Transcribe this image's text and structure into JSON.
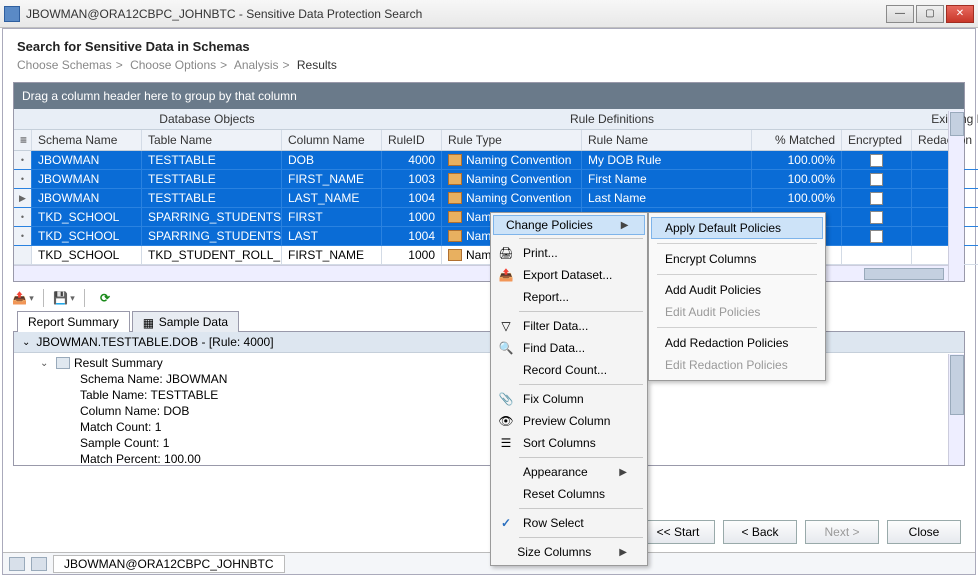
{
  "window": {
    "title": "JBOWMAN@ORA12CBPC_JOHNBTC - Sensitive Data Protection Search"
  },
  "header": {
    "title": "Search for Sensitive Data in Schemas",
    "crumbs": [
      "Choose Schemas",
      "Choose Options",
      "Analysis",
      "Results"
    ]
  },
  "grid": {
    "group_hint": "Drag a column header here to group by that column",
    "bands": {
      "db": "Database Objects",
      "rules": "Rule Definitions",
      "policies": "Existing Policies"
    },
    "cols": {
      "schema": "Schema Name",
      "table": "Table Name",
      "column": "Column Name",
      "ruleid": "RuleID",
      "ruletype": "Rule Type",
      "rulename": "Rule Name",
      "matched": "% Matched",
      "encrypted": "Encrypted",
      "redaction": "Redaction"
    },
    "rows": [
      {
        "sel": true,
        "ind": "•",
        "schema": "JBOWMAN",
        "table": "TESTTABLE",
        "column": "DOB",
        "ruleid": "4000",
        "ruletype": "Naming Convention",
        "rulename": "My DOB Rule",
        "matched": "100.00%"
      },
      {
        "sel": true,
        "ind": "•",
        "schema": "JBOWMAN",
        "table": "TESTTABLE",
        "column": "FIRST_NAME",
        "ruleid": "1003",
        "ruletype": "Naming Convention",
        "rulename": "First Name",
        "matched": "100.00%"
      },
      {
        "sel": true,
        "ind": "▶",
        "schema": "JBOWMAN",
        "table": "TESTTABLE",
        "column": "LAST_NAME",
        "ruleid": "1004",
        "ruletype": "Naming Convention",
        "rulename": "Last Name",
        "matched": "100.00%"
      },
      {
        "sel": true,
        "ind": "•",
        "schema": "TKD_SCHOOL",
        "table": "SPARRING_STUDENTS",
        "column": "FIRST",
        "ruleid": "1000",
        "ruletype": "Naming Con",
        "rulename": "",
        "matched": ""
      },
      {
        "sel": true,
        "ind": "•",
        "schema": "TKD_SCHOOL",
        "table": "SPARRING_STUDENTS",
        "column": "LAST",
        "ruleid": "1004",
        "ruletype": "Naming Con",
        "rulename": "",
        "matched": ""
      },
      {
        "sel": false,
        "ind": "",
        "schema": "TKD_SCHOOL",
        "table": "TKD_STUDENT_ROLL_...",
        "column": "FIRST_NAME",
        "ruleid": "1000",
        "ruletype": "Naming Con",
        "rulename": "",
        "matched": ""
      }
    ]
  },
  "tabs": {
    "summary": "Report Summary",
    "sample": "Sample Data"
  },
  "tree": {
    "header": "JBOWMAN.TESTTABLE.DOB - [Rule: 4000]",
    "root": "Result Summary",
    "items": [
      "Schema Name: JBOWMAN",
      "Table Name: TESTTABLE",
      "Column Name: DOB",
      "Match Count: 1",
      "Sample Count: 1",
      "Match Percent: 100.00"
    ]
  },
  "context": {
    "items": {
      "change_policies": "Change Policies",
      "print": "Print...",
      "export": "Export Dataset...",
      "report": "Report...",
      "filter": "Filter Data...",
      "find": "Find Data...",
      "record": "Record Count...",
      "fix": "Fix Column",
      "preview": "Preview Column",
      "sort": "Sort Columns",
      "appearance": "Appearance",
      "reset": "Reset Columns",
      "rowselect": "Row Select",
      "size": "Size Columns"
    }
  },
  "submenu": {
    "apply_default": "Apply Default Policies",
    "encrypt": "Encrypt Columns",
    "add_audit": "Add Audit Policies",
    "edit_audit": "Edit Audit Policies",
    "add_redaction": "Add Redaction Policies",
    "edit_redaction": "Edit Redaction Policies"
  },
  "buttons": {
    "start": "<< Start",
    "back": "< Back",
    "next": "Next >",
    "close": "Close"
  },
  "status": {
    "conn": "JBOWMAN@ORA12CBPC_JOHNBTC"
  }
}
